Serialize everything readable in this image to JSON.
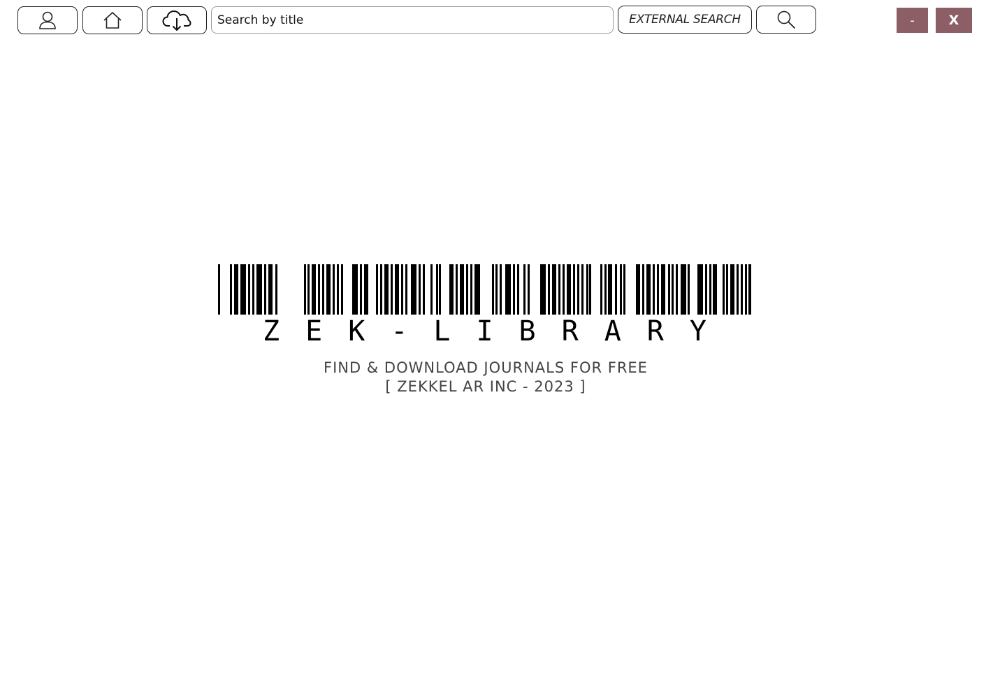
{
  "toolbar": {
    "user_icon": "user-icon",
    "home_icon": "home-icon",
    "download_icon": "cloud-download-icon",
    "search_placeholder": "Search by title",
    "external_search_label": "EXTERNAL SEARCH",
    "search_icon": "magnifier-icon"
  },
  "window_controls": {
    "minimize_label": "-",
    "close_label": "X",
    "button_color": "#8c5f66"
  },
  "splash": {
    "logo_text": "ZEK-LIBRARY",
    "tagline": "FIND & DOWNLOAD JOURNALS FOR FREE",
    "copyright": "[ ZEKKEL AR INC - 2023 ]"
  }
}
